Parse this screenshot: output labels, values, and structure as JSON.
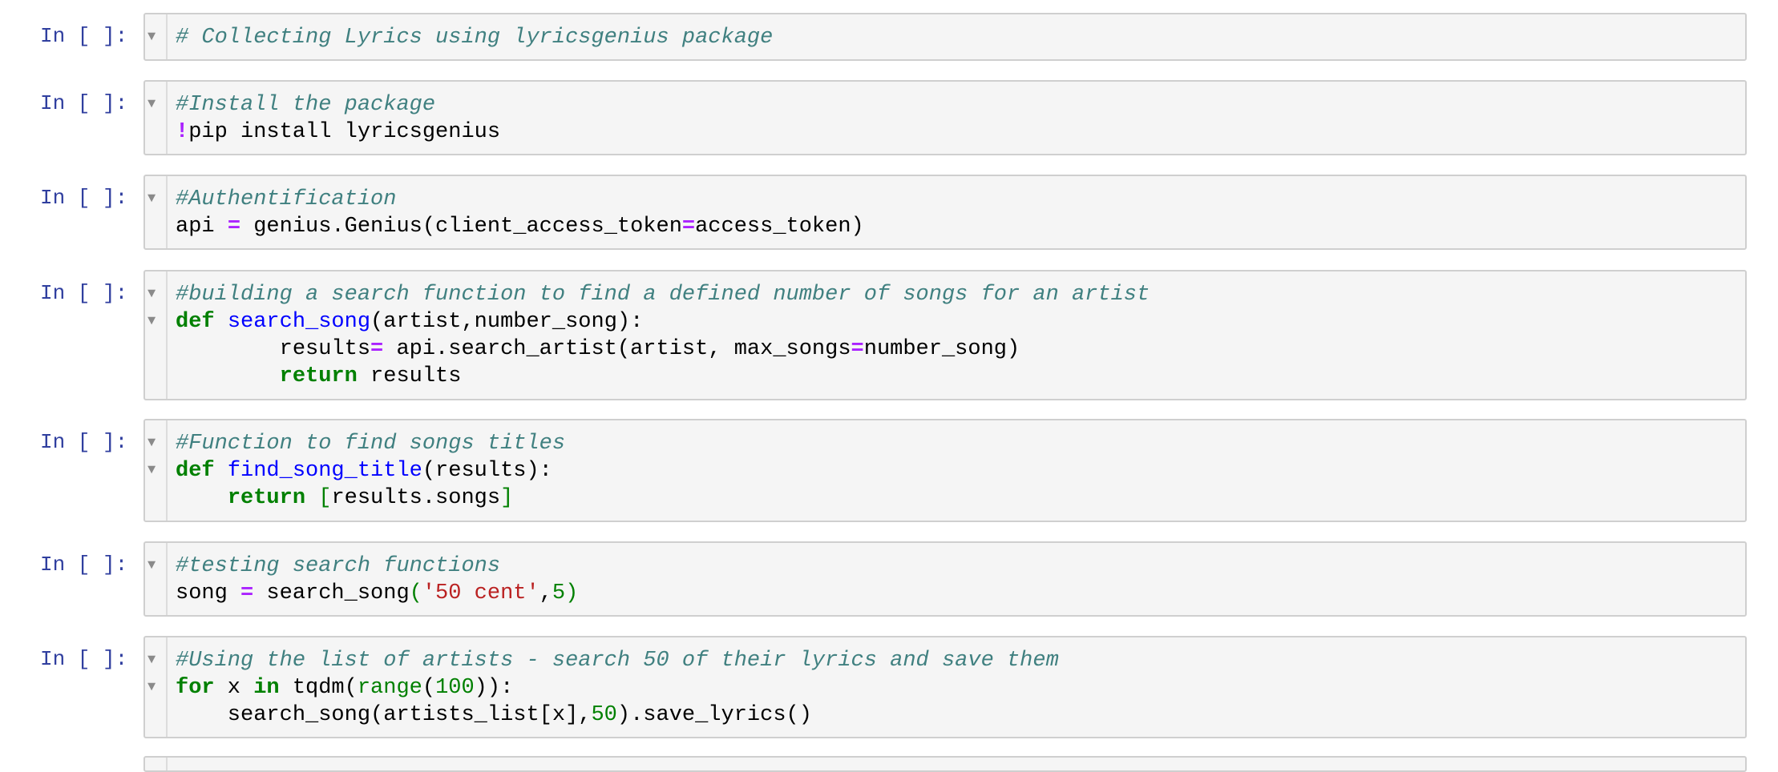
{
  "cells": [
    {
      "prompt": "In [ ]:",
      "lines": [
        [
          {
            "cls": "c",
            "t": "# Collecting Lyrics using lyricsgenius package"
          }
        ]
      ]
    },
    {
      "prompt": "In [ ]:",
      "lines": [
        [
          {
            "cls": "c",
            "t": "#Install the package"
          }
        ],
        [
          {
            "cls": "o",
            "t": "!"
          },
          {
            "cls": "",
            "t": "pip install lyricsgenius"
          }
        ]
      ]
    },
    {
      "prompt": "In [ ]:",
      "lines": [
        [
          {
            "cls": "c",
            "t": "#Authentification"
          }
        ],
        [
          {
            "cls": "",
            "t": "api "
          },
          {
            "cls": "o",
            "t": "="
          },
          {
            "cls": "",
            "t": " genius.Genius(client_access_token"
          },
          {
            "cls": "o",
            "t": "="
          },
          {
            "cls": "",
            "t": "access_token)"
          }
        ]
      ]
    },
    {
      "prompt": "In [ ]:",
      "lines": [
        [
          {
            "cls": "c",
            "t": "#building a search function to find a defined number of songs for an artist"
          }
        ],
        [
          {
            "cls": "k",
            "t": "def"
          },
          {
            "cls": "",
            "t": " "
          },
          {
            "cls": "f",
            "t": "search_song"
          },
          {
            "cls": "",
            "t": "(artist,number_song):"
          }
        ],
        [
          {
            "cls": "",
            "t": "        results"
          },
          {
            "cls": "o",
            "t": "="
          },
          {
            "cls": "",
            "t": " api.search_artist(artist, max_songs"
          },
          {
            "cls": "o",
            "t": "="
          },
          {
            "cls": "",
            "t": "number_song)"
          }
        ],
        [
          {
            "cls": "",
            "t": "        "
          },
          {
            "cls": "k",
            "t": "return"
          },
          {
            "cls": "",
            "t": " results"
          }
        ]
      ]
    },
    {
      "prompt": "In [ ]:",
      "lines": [
        [
          {
            "cls": "c",
            "t": "#Function to find songs titles"
          }
        ],
        [
          {
            "cls": "k",
            "t": "def"
          },
          {
            "cls": "",
            "t": " "
          },
          {
            "cls": "f",
            "t": "find_song_title"
          },
          {
            "cls": "",
            "t": "(results):"
          }
        ],
        [
          {
            "cls": "",
            "t": "    "
          },
          {
            "cls": "k",
            "t": "return"
          },
          {
            "cls": "",
            "t": " "
          },
          {
            "cls": "p",
            "t": "["
          },
          {
            "cls": "",
            "t": "results.songs"
          },
          {
            "cls": "p",
            "t": "]"
          }
        ]
      ]
    },
    {
      "prompt": "In [ ]:",
      "lines": [
        [
          {
            "cls": "c",
            "t": "#testing search functions"
          }
        ],
        [
          {
            "cls": "",
            "t": "song "
          },
          {
            "cls": "o",
            "t": "="
          },
          {
            "cls": "",
            "t": " search_song"
          },
          {
            "cls": "p",
            "t": "("
          },
          {
            "cls": "s",
            "t": "'50 cent'"
          },
          {
            "cls": "",
            "t": ","
          },
          {
            "cls": "m",
            "t": "5"
          },
          {
            "cls": "p",
            "t": ")"
          }
        ]
      ]
    },
    {
      "prompt": "In [ ]:",
      "lines": [
        [
          {
            "cls": "c",
            "t": "#Using the list of artists - search 50 of their lyrics and save them"
          }
        ],
        [
          {
            "cls": "k",
            "t": "for"
          },
          {
            "cls": "",
            "t": " x "
          },
          {
            "cls": "k",
            "t": "in"
          },
          {
            "cls": "",
            "t": " tqdm("
          },
          {
            "cls": "b",
            "t": "range"
          },
          {
            "cls": "",
            "t": "("
          },
          {
            "cls": "m",
            "t": "100"
          },
          {
            "cls": "",
            "t": ")):"
          }
        ],
        [
          {
            "cls": "",
            "t": "    search_song(artists_list[x],"
          },
          {
            "cls": "m",
            "t": "50"
          },
          {
            "cls": "",
            "t": ").save_lyrics()"
          }
        ]
      ]
    }
  ]
}
